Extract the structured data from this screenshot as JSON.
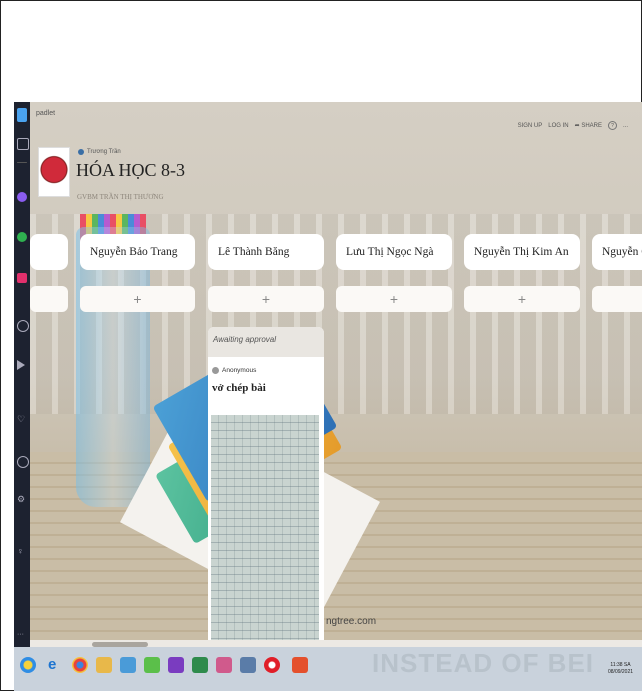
{
  "app": {
    "brand": "padlet"
  },
  "topnav": {
    "sign_up": "SIGN UP",
    "log_in": "LOG IN",
    "share": "SHARE",
    "help": "?",
    "more": "..."
  },
  "board": {
    "author": "Trương Trần",
    "title": "HÓA HỌC 8-3",
    "subtitle": "GVBM TRẦN THỊ THƯƠNG"
  },
  "columns": [
    {
      "label": "Nguyễn Bảo Trang"
    },
    {
      "label": "Lê Thành Băng"
    },
    {
      "label": "Lưu Thị Ngọc Ngà"
    },
    {
      "label": "Nguyễn Thị Kim An"
    },
    {
      "label": "Nguyễn Qu"
    }
  ],
  "add_post_label": "+",
  "post": {
    "status": "Awaiting approval",
    "author": "Anonymous",
    "title": "vở chép bài"
  },
  "watermark": "ngtree.com",
  "taskbar": {
    "banner": "INSTEAD OF BEI",
    "time": "11:38 SA",
    "date": "08/09/2021"
  },
  "colors": {
    "pad_bg": "#cfc8bb",
    "header_white": "#ffffff",
    "dark_sidebar": "#1d2230"
  }
}
